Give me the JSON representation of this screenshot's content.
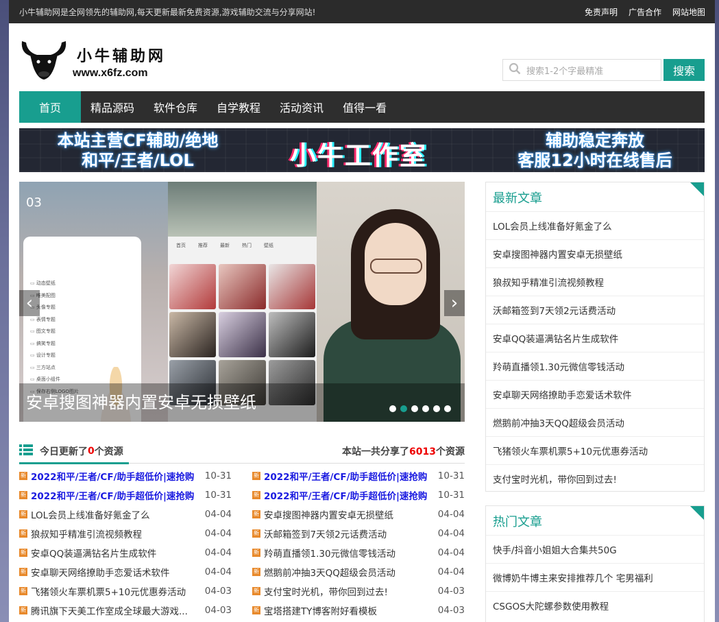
{
  "topbar": {
    "intro": "小牛辅助网是全网领先的辅助网,每天更新最新免费资源,游戏辅助交流与分享网站!",
    "links": [
      "免责声明",
      "广告合作",
      "网站地图"
    ]
  },
  "logo": {
    "name": "小牛辅助网",
    "url": "www.x6fz.com"
  },
  "search": {
    "placeholder": "搜索1-2个字最精准",
    "button": "搜索"
  },
  "nav": [
    "首页",
    "精品源码",
    "软件仓库",
    "自学教程",
    "活动资讯",
    "值得一看"
  ],
  "banner": {
    "left_line1": "本站主营CF辅助/绝地",
    "left_line2": "和平/王者/LOL",
    "middle": "小牛工作室",
    "right_line1": "辅助稳定奔放",
    "right_line2": "客服12小时在线售后"
  },
  "slider": {
    "caption": "安卓搜图神器内置安卓无损壁纸",
    "phone_number": "03",
    "phone_tabs": [
      "首页",
      "推荐",
      "最新",
      "热门",
      "壁纸"
    ],
    "menu": [
      "动态壁纸",
      "唯美配图",
      "头像专题",
      "表情专题",
      "图文专题",
      "搞笑专题",
      "设计专题",
      "三方站点",
      "桌面小组件",
      "保存右侧LOGO图片"
    ],
    "active_dot": 1,
    "dot_count": 6
  },
  "updates": {
    "today_prefix": "今日更新了",
    "today_count": "0",
    "today_suffix": "个资源",
    "total_prefix": "本站一共分享了",
    "total_count": "6013",
    "total_suffix": "个资源",
    "badge": "新",
    "left": [
      {
        "title": "2022和平/王者/CF/助手超低价|速抢购",
        "date": "10-31",
        "hot": true
      },
      {
        "title": "2022和平/王者/CF/助手超低价|速抢购",
        "date": "10-31",
        "hot": true
      },
      {
        "title": "LOL会员上线准备好氪金了么",
        "date": "04-04",
        "hot": false
      },
      {
        "title": "狼叔知乎精准引流视频教程",
        "date": "04-04",
        "hot": false
      },
      {
        "title": "安卓QQ装逼满钻名片生成软件",
        "date": "04-04",
        "hot": false
      },
      {
        "title": "安卓聊天网络撩助手恋爱话术软件",
        "date": "04-04",
        "hot": false
      },
      {
        "title": "飞猪领火车票机票5+10元优惠券活动",
        "date": "04-03",
        "hot": false
      },
      {
        "title": "腾讯旗下天美工作室成全球最大游戏...",
        "date": "04-03",
        "hot": false
      }
    ],
    "right": [
      {
        "title": "2022和平/王者/CF/助手超低价|速抢购",
        "date": "10-31",
        "hot": true
      },
      {
        "title": "2022和平/王者/CF/助手超低价|速抢购",
        "date": "10-31",
        "hot": true
      },
      {
        "title": "安卓搜图神器内置安卓无损壁纸",
        "date": "04-04",
        "hot": false
      },
      {
        "title": "沃邮箱签到7天领2元话费活动",
        "date": "04-04",
        "hot": false
      },
      {
        "title": "羚萌直播领1.30元微信零钱活动",
        "date": "04-04",
        "hot": false
      },
      {
        "title": "燃鹅前冲抽3天QQ超级会员活动",
        "date": "04-04",
        "hot": false
      },
      {
        "title": "支付宝时光机，带你回到过去!",
        "date": "04-03",
        "hot": false
      },
      {
        "title": "宝塔搭建TY博客附好看模板",
        "date": "04-03",
        "hot": false
      }
    ]
  },
  "latest": {
    "title": "最新文章",
    "items": [
      "LOL会员上线准备好氪金了么",
      "安卓搜图神器内置安卓无损壁纸",
      "狼叔知乎精准引流视频教程",
      "沃邮箱签到7天领2元话费活动",
      "安卓QQ装逼满钻名片生成软件",
      "羚萌直播领1.30元微信零钱活动",
      "安卓聊天网络撩助手恋爱话术软件",
      "燃鹅前冲抽3天QQ超级会员活动",
      "飞猪领火车票机票5+10元优惠券活动",
      "支付宝时光机，带你回到过去!"
    ]
  },
  "hot": {
    "title": "热门文章",
    "items": [
      "快手/抖音小姐姐大合集共50G",
      "微博奶牛博主来安排推荐几个 宅男福利",
      "CSGOS大陀螺参数使用教程"
    ]
  },
  "colors": {
    "accent": "#189e8f",
    "nav_bg": "#2e2e2e",
    "topbar_bg": "#2b2b2b",
    "hot_link": "#1a1ae0",
    "count_red": "#e00000"
  }
}
